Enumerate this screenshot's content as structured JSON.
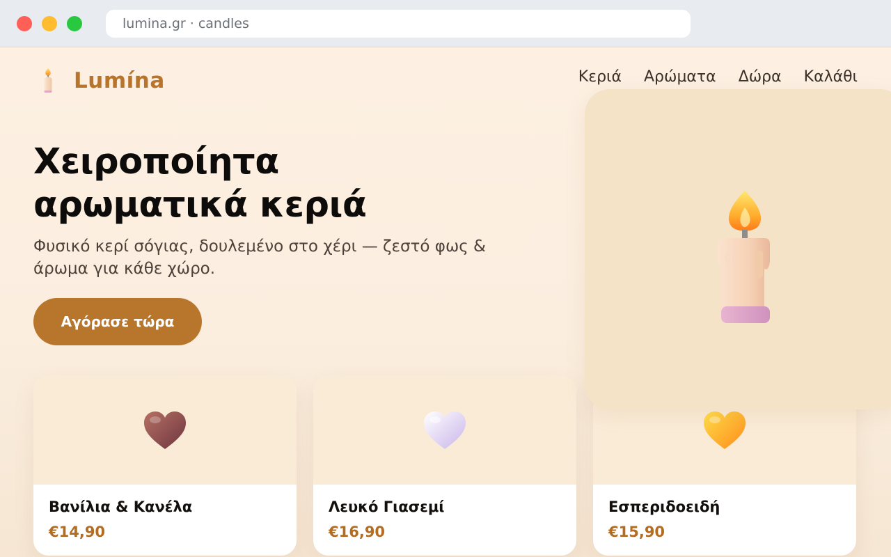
{
  "browser": {
    "url": "lumina.gr · candles"
  },
  "brand": {
    "name": "Lumína",
    "icon": "candle-icon",
    "color": "#b8742a"
  },
  "nav": {
    "items": [
      "Κεριά",
      "Αρώματα",
      "Δώρα",
      "Καλάθι"
    ]
  },
  "hero": {
    "title_line1": "Χειροποίητα",
    "title_line2": "αρωματικά κεριά",
    "subtitle": "Φυσικό κερί σόγιας, δουλεμένο στο χέρι — ζεστό φως & άρωμα για κάθε χώρο.",
    "cta_label": "Αγόρασε τώρα",
    "image_icon": "lit-candle-icon"
  },
  "products": [
    {
      "name": "Βανίλια & Κανέλα",
      "price": "€14,90",
      "icon": "brown-heart-icon",
      "color": "#8c4a4a"
    },
    {
      "name": "Λευκό Γιασεμί",
      "price": "€16,90",
      "icon": "white-heart-icon",
      "color": "#e6dcf4"
    },
    {
      "name": "Εσπεριδοειδή",
      "price": "€15,90",
      "icon": "orange-heart-icon",
      "color": "#ffb020"
    }
  ],
  "colors": {
    "accent": "#b8762c",
    "price": "#b26d23",
    "background": "#fdf0e2"
  }
}
